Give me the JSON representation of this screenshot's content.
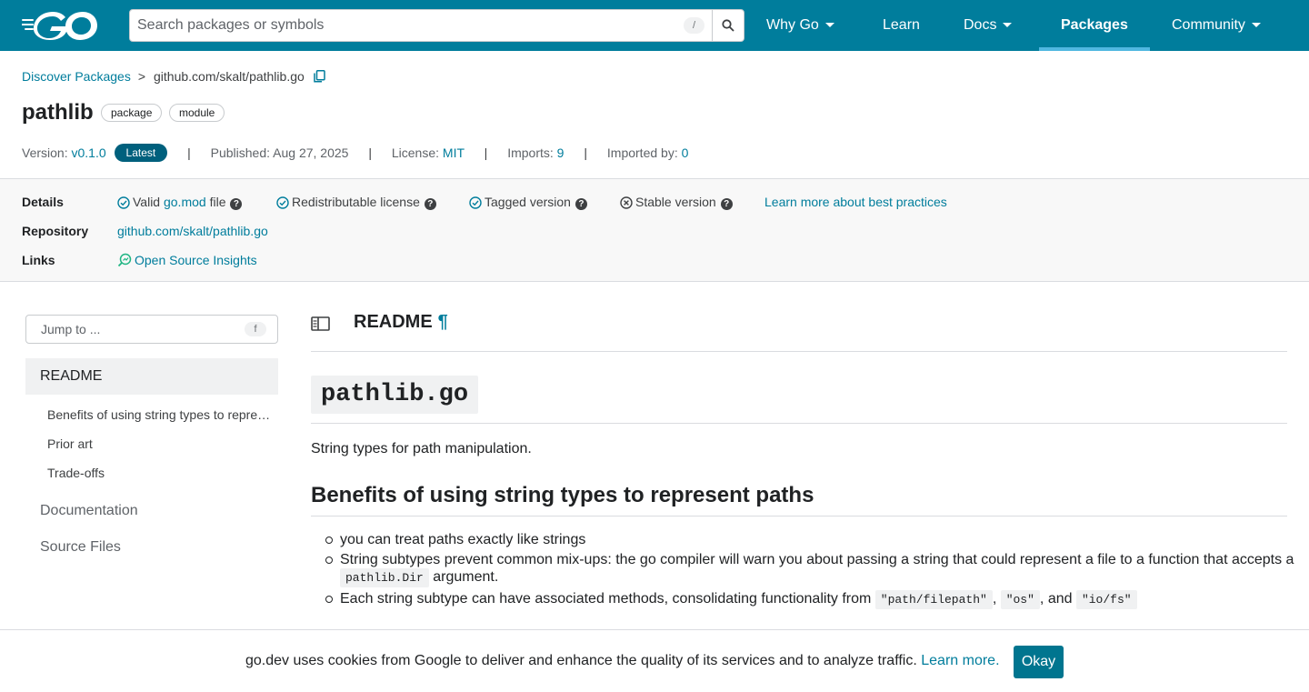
{
  "header": {
    "logo_alt": "GO",
    "search": {
      "placeholder": "Search packages or symbols",
      "shortcut": "/"
    },
    "nav": [
      {
        "label": "Why Go",
        "has_caret": true
      },
      {
        "label": "Learn",
        "has_caret": false
      },
      {
        "label": "Docs",
        "has_caret": true
      },
      {
        "label": "Packages",
        "has_caret": false,
        "active": true
      },
      {
        "label": "Community",
        "has_caret": true
      }
    ],
    "brand_color": "#007d9c"
  },
  "breadcrumb": {
    "root": "Discover Packages",
    "separator": ">",
    "path": "github.com/skalt/pathlib.go"
  },
  "package": {
    "name": "pathlib",
    "chips": [
      "package",
      "module"
    ],
    "meta": {
      "version_label": "Version:",
      "version": "v0.1.0",
      "latest": "Latest",
      "published_label": "Published:",
      "published": "Aug 27, 2025",
      "license_label": "License:",
      "license": "MIT",
      "imports_label": "Imports:",
      "imports": "9",
      "imported_by_label": "Imported by:",
      "imported_by": "0"
    }
  },
  "details": {
    "details_label": "Details",
    "checks": [
      {
        "pre": "Valid ",
        "link": "go.mod",
        "post": " file",
        "status": "check"
      },
      {
        "pre": "Redistributable license",
        "link": "",
        "post": "",
        "status": "check"
      },
      {
        "pre": "Tagged version",
        "link": "",
        "post": "",
        "status": "check"
      },
      {
        "pre": "Stable version",
        "link": "",
        "post": "",
        "status": "cross"
      }
    ],
    "best_practices": "Learn more about best practices",
    "repository_label": "Repository",
    "repository": "github.com/skalt/pathlib.go",
    "links_label": "Links",
    "insights": "Open Source Insights"
  },
  "sidebar": {
    "jump_placeholder": "Jump to ...",
    "jump_shortcut": "f",
    "readme": "README",
    "sub_items": [
      "Benefits of using string types to represent paths",
      "Prior art",
      "Trade-offs"
    ],
    "documentation": "Documentation",
    "source_files": "Source Files"
  },
  "readme": {
    "header": "README",
    "pilcrow": "¶",
    "h1": "pathlib.go",
    "intro": "String types for path manipulation.",
    "h2": "Benefits of using string types to represent paths",
    "bullets": {
      "b1": "you can treat paths exactly like strings",
      "b2_pre": "String subtypes prevent common mix-ups: the go compiler will warn you about passing a string that could represent a file to a function that accepts a ",
      "b2_code": "pathlib.Dir",
      "b2_post": " argument.",
      "b3_pre": "Each string subtype can have associated methods, consolidating functionality from ",
      "b3_code1": "\"path/filepath\"",
      "b3_sep1": ", ",
      "b3_code2": "\"os\"",
      "b3_sep2": ", and ",
      "b3_code3": "\"io/fs\""
    }
  },
  "cookie": {
    "message": "go.dev uses cookies from Google to deliver and enhance the quality of its services and to analyze traffic.",
    "learn_more": "Learn more.",
    "ok": "Okay"
  }
}
